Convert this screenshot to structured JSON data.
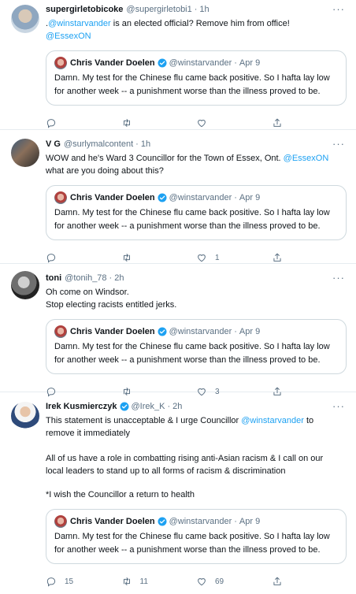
{
  "tweets": [
    {
      "name": "supergirletobicoke",
      "handle": "@supergirletobi1",
      "time": "1h",
      "text1_prefix": ".",
      "text1_mention": "@winstarvander",
      "text1_suffix": " is an elected official? Remove him from office!",
      "text2_mention": "@EssexON",
      "quote": {
        "name": "Chris Vander Doelen",
        "handle": "@winstarvander",
        "date": "Apr 9",
        "line1": "Damn. My test for the Chinese flu came back positive. So I hafta lay low",
        "line2": "for another week -- a punishment worse than the illness proved to be."
      },
      "counts": {
        "replies": "",
        "retweets": "",
        "likes": ""
      }
    },
    {
      "name": "V G",
      "handle": "@surlymalcontent",
      "time": "1h",
      "text1": "WOW and he's Ward 3 Councillor for the Town of Essex, Ont. ",
      "text1_mention": "@EssexON",
      "text2": "what are you doing about this?",
      "quote": {
        "name": "Chris Vander Doelen",
        "handle": "@winstarvander",
        "date": "Apr 9",
        "line1": "Damn. My test for the Chinese flu came back positive. So I hafta lay low",
        "line2": "for another week -- a punishment worse than the illness proved to be."
      },
      "counts": {
        "replies": "",
        "retweets": "",
        "likes": "1"
      }
    },
    {
      "name": "toni",
      "handle": "@tonih_78",
      "time": "2h",
      "text1": "Oh come on Windsor.",
      "text2": "Stop electing racists entitled jerks.",
      "quote": {
        "name": "Chris Vander Doelen",
        "handle": "@winstarvander",
        "date": "Apr 9",
        "line1": "Damn. My test for the Chinese flu came back positive. So I hafta lay low",
        "line2": "for another week -- a punishment worse than the illness proved to be."
      },
      "counts": {
        "replies": "",
        "retweets": "",
        "likes": "3"
      }
    },
    {
      "name": "Irek Kusmierczyk",
      "handle": "@Irek_K",
      "time": "2h",
      "text1": "This statement is unacceptable & I urge Councillor ",
      "text1_mention": "@winstarvander",
      "text1_suffix": " to",
      "text2": "remove it immediately",
      "text3": "All of us have a role in combatting rising anti-Asian racism & I call on our",
      "text4": "local leaders to stand up to all forms of racism & discrimination",
      "text5": "*I wish the Councillor a return to health",
      "quote": {
        "name": "Chris Vander Doelen",
        "handle": "@winstarvander",
        "date": "Apr 9",
        "line1": "Damn. My test for the Chinese flu came back positive. So I hafta lay low",
        "line2": "for another week -- a punishment worse than the illness proved to be."
      },
      "counts": {
        "replies": "15",
        "retweets": "11",
        "likes": "69"
      }
    }
  ],
  "separator": "·",
  "more_glyph": "···",
  "colors": {
    "link": "#1da1f2",
    "muted": "#5b7083",
    "verified": "#1da1f2",
    "border": "#cfd9de"
  }
}
